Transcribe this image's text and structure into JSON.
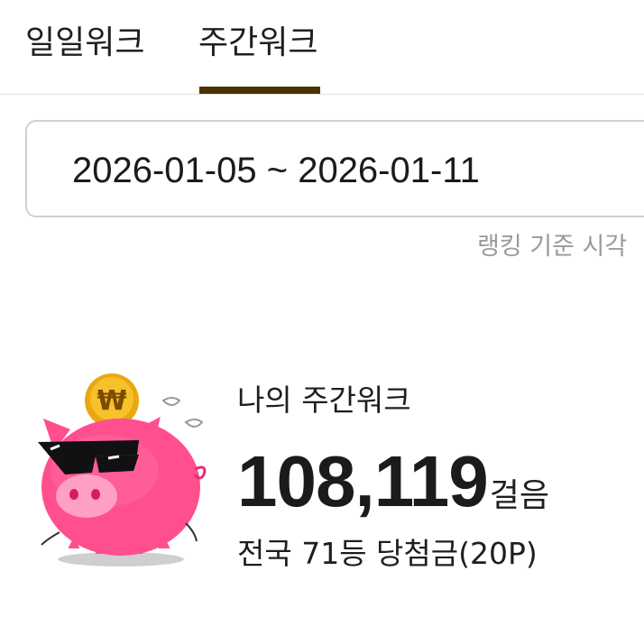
{
  "tabs": [
    {
      "label": "일일워크",
      "selected": false
    },
    {
      "label": "주간워크",
      "selected": true
    }
  ],
  "colors": {
    "tab_indicator": "#4a3300",
    "pig_pink": "#ff4f8e",
    "coin_gold": "#f2b21b",
    "muted_text": "#9a9a9a"
  },
  "date_range": "2026-01-05 ~ 2026-01-11",
  "ranking_note": "랭킹 기준 시각",
  "summary": {
    "title": "나의 주간워크",
    "steps": "108,119",
    "steps_unit": "걸음",
    "rank_line": "전국 71등 당첨금(20P)"
  },
  "illustration": {
    "name": "piggy-bank-with-sunglasses",
    "coin_symbol": "₩"
  }
}
